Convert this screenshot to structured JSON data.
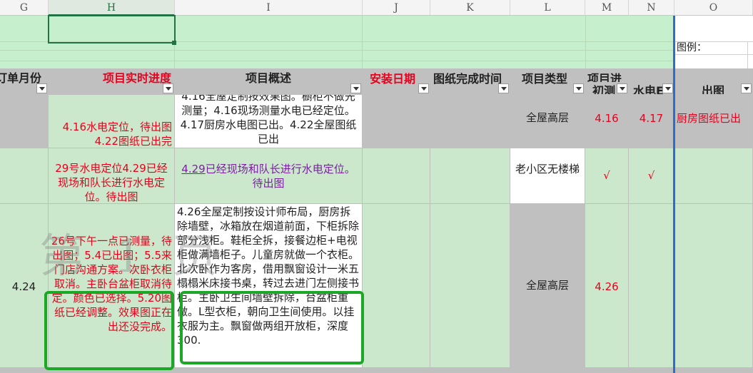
{
  "columns": [
    "G",
    "H",
    "I",
    "J",
    "K",
    "L",
    "M",
    "N",
    "O"
  ],
  "legend_label": "图例：",
  "headers": {
    "order_month": "订单月份",
    "progress": "项目实时进度",
    "overview": "项目概述",
    "install_date": "安装日期",
    "drawing_date": "图纸完成时间",
    "type": "项目类型",
    "progress_group": "项目进",
    "initial_measure": "初测",
    "water_elec": "水电E",
    "drawing": "出图"
  },
  "rows": [
    {
      "order_month": "",
      "progress": "4.16水电定位，待出图  4.22图纸已出完",
      "overview": "4.16全屋定制按效果图。橱柜不做先测量；4.16现场测量水电已经定位。 4.17厨房水电图已出。4.22全屋图纸已出",
      "type": "全屋高层",
      "initial_measure": "4.16",
      "water_elec": "4.17",
      "drawing": "厨房图纸已出"
    },
    {
      "order_month": "",
      "progress": "29号水电定位4.29已经现场和队长进行水电定位。待出图",
      "overview_link": "4.29",
      "overview": "已经现场和队长进行水电定位。待出图",
      "type": "老小区无楼梯",
      "initial_measure": "√",
      "water_elec": "√",
      "drawing": ""
    },
    {
      "order_month": "4.24",
      "progress": "26号下午一点已测量，待出图；5.4已出图；5.5来门店沟通方案。次卧衣柜取消。主卧台盆柜取消待定。颜色已选择。5.20图纸已经调整。效果图正在出还没完成。",
      "overview": "4.26全屋定制按设计师布局，厨房拆除墙壁，冰箱放在烟道前面，下柜拆除部分浅柜。鞋柜全拆，接餐边柜+电视柜做满墙柜子。儿童房就做一个衣柜。北次卧作为客房，借用飘窗设计一米五榻榻米床接书桌，转过去进门左侧接书柜。主卧卫生间墙壁拆除，台盆柜重做。L型衣柜，朝向卫生间使用。以挂衣服为主。飘窗做两组开放柜，深度300.",
      "type": "全屋高层",
      "initial_measure": "4.26",
      "water_elec": "",
      "drawing": ""
    }
  ],
  "watermark": "第  1  页",
  "colors": {
    "green_fill": "#cce8cc",
    "gray_fill": "#c0c0c0",
    "red_text": "#e8001c",
    "highlight_box": "#1aa826",
    "selection": "#217346"
  }
}
